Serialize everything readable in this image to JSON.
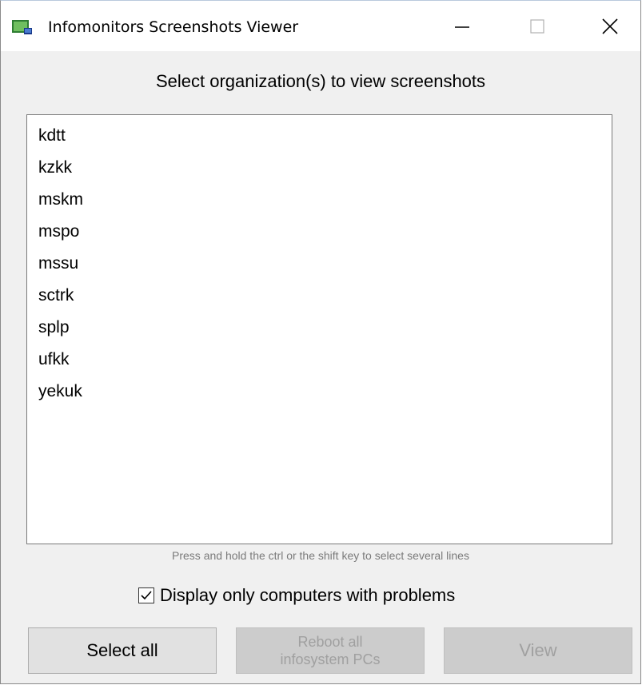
{
  "window": {
    "title": "Infomonitors Screenshots Viewer",
    "controls": {
      "minimize": "—",
      "maximize": "☐",
      "close": "✕"
    }
  },
  "heading": "Select organization(s) to view screenshots",
  "organizations": [
    "kdtt",
    "kzkk",
    "mskm",
    "mspo",
    "mssu",
    "sctrk",
    "splp",
    "ufkk",
    "yekuk"
  ],
  "hint": "Press and hold the ctrl or the shift key to select several lines",
  "filter": {
    "label": "Display only computers with problems",
    "checked": true
  },
  "buttons": {
    "select_all": "Select all",
    "reboot_line1": "Reboot all",
    "reboot_line2": "infosystem PCs",
    "view": "View"
  },
  "colors": {
    "app_icon_green": "#3a8a3a",
    "disabled_text": "#a0a0a0"
  },
  "icons": {
    "app": "app-window-icon",
    "check": "checkmark-icon"
  }
}
